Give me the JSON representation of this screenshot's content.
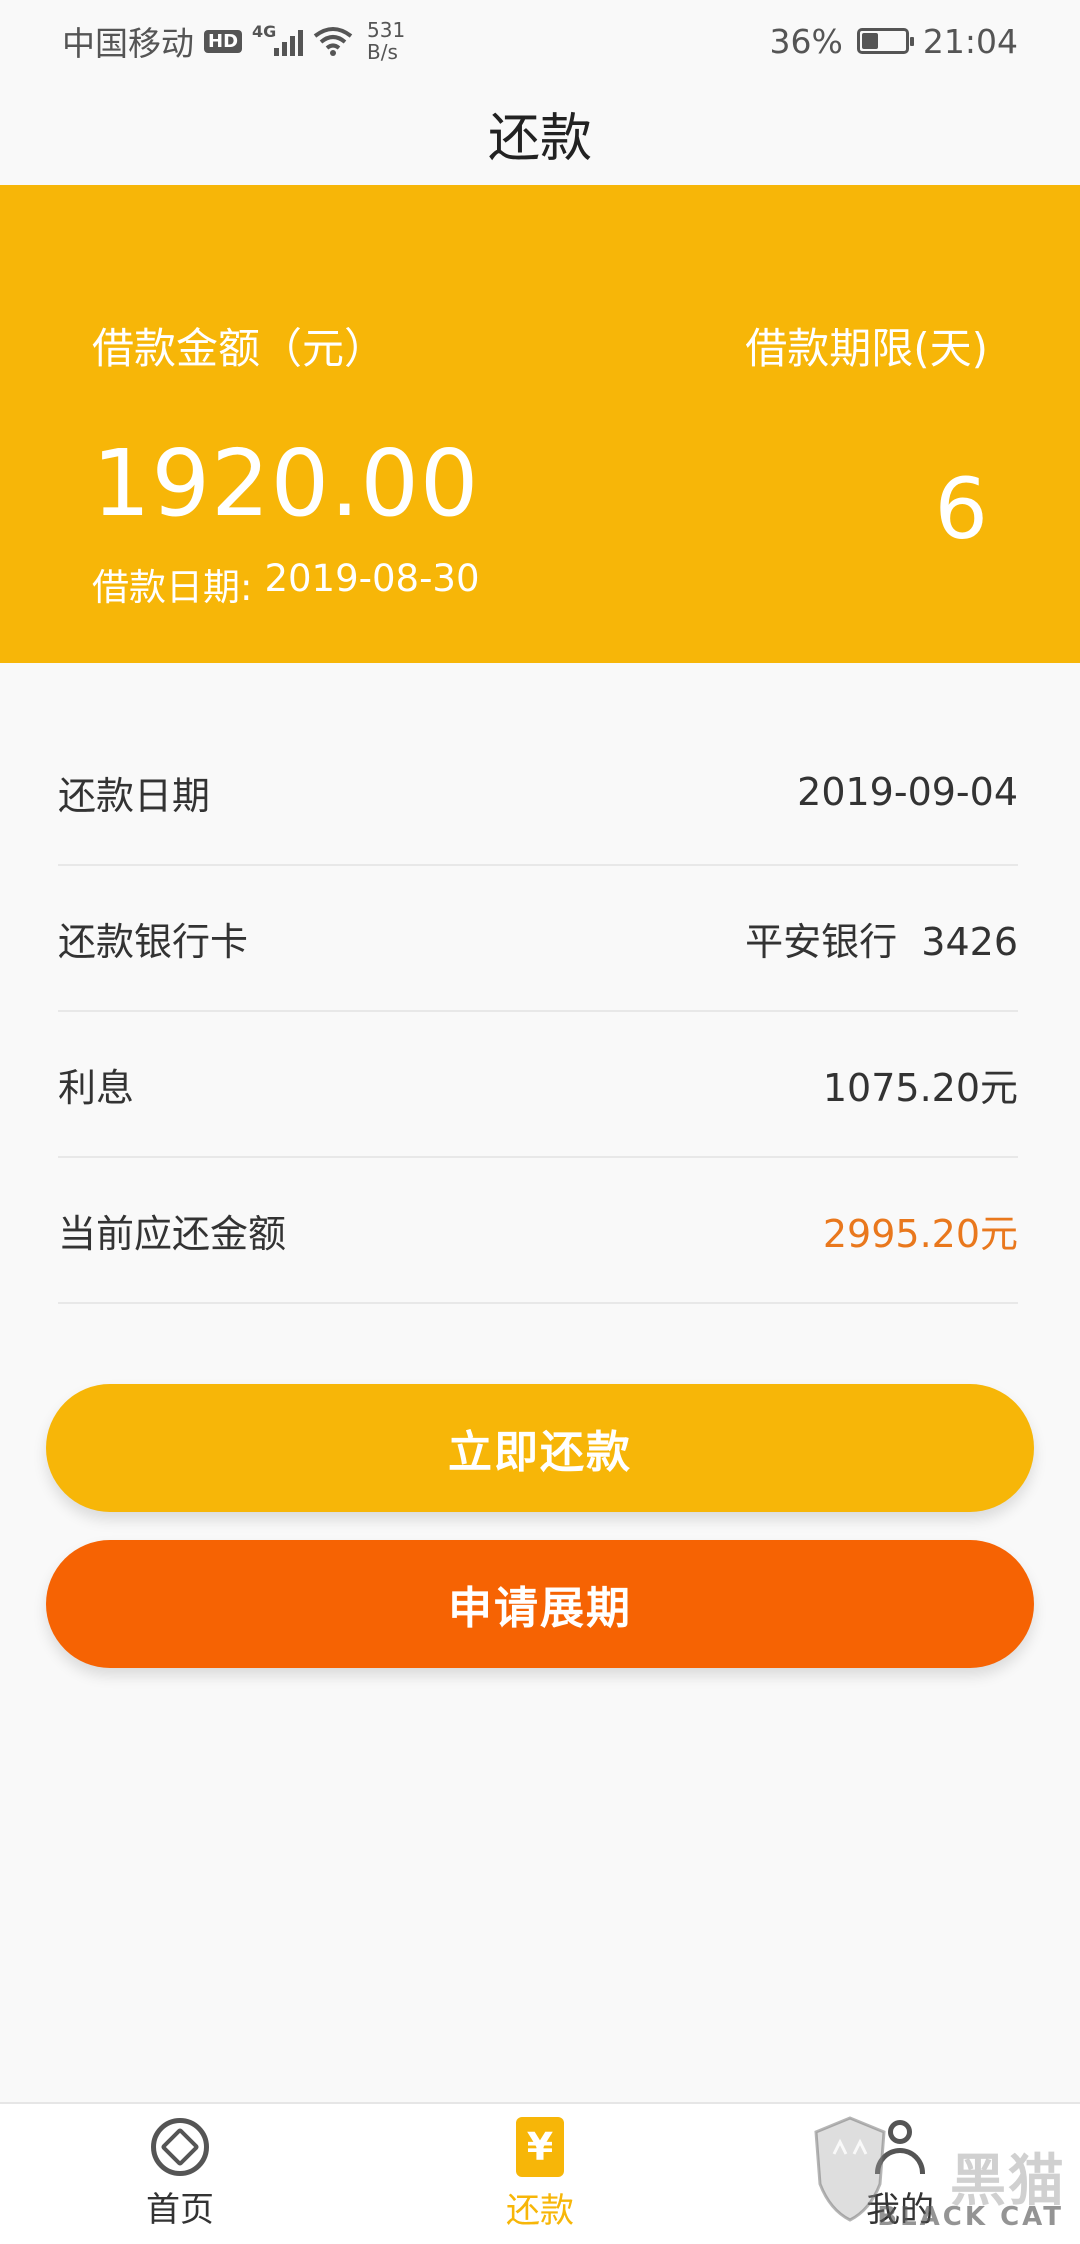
{
  "status_bar": {
    "carrier": "中国移动",
    "hd": "HD",
    "network": "4G",
    "speed_value": "531",
    "speed_unit": "B/s",
    "battery": "36%",
    "battery_level": 0.36,
    "time": "21:04"
  },
  "header": {
    "title": "还款"
  },
  "loan": {
    "amount_label": "借款金额（元）",
    "term_label": "借款期限(天)",
    "amount": "1920.00",
    "term": "6",
    "date_label": "借款日期:",
    "date": "2019-08-30"
  },
  "details": [
    {
      "label": "还款日期",
      "value": "2019-09-04"
    },
    {
      "label": "还款银行卡",
      "value": "平安银行  3426"
    },
    {
      "label": "利息",
      "value": "1075.20元"
    },
    {
      "label": "当前应还金额",
      "value": "2995.20元"
    }
  ],
  "buttons": {
    "repay": "立即还款",
    "extend": "申请展期"
  },
  "tabs": [
    {
      "label": "首页",
      "icon": "home-icon"
    },
    {
      "label": "还款",
      "icon": "repay-icon"
    },
    {
      "label": "我的",
      "icon": "profile-icon"
    }
  ],
  "watermark": {
    "text": "黑猫",
    "sub": "BLACK CAT"
  },
  "colors": {
    "primary": "#f7b608",
    "accent": "#f66303",
    "highlight": "#e9781d"
  }
}
